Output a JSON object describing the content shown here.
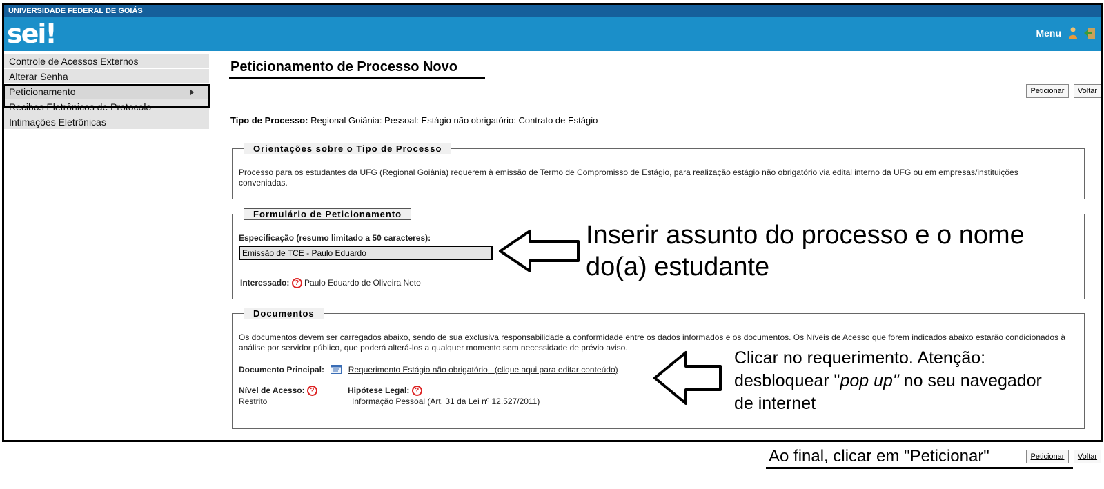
{
  "header": {
    "university": "UNIVERSIDADE FEDERAL DE GOIÁS",
    "logo_text": "sei",
    "logo_mark": "!",
    "menu_label": "Menu",
    "icons": [
      "user-icon",
      "exit-icon"
    ],
    "bar_color": "#1b8fc9",
    "top_bar_color": "#155f9b"
  },
  "sidebar": {
    "items": [
      {
        "label": "Controle de Acessos Externos"
      },
      {
        "label": "Alterar Senha"
      },
      {
        "label": "Peticionamento"
      },
      {
        "label": "Recibos Eletrônicos de Protocolo"
      },
      {
        "label": "Intimações Eletrônicas"
      }
    ]
  },
  "main": {
    "title": "Peticionamento de Processo Novo",
    "buttons": {
      "peticionar": "Peticionar",
      "voltar": "Voltar"
    },
    "tipo_label": "Tipo de Processo:",
    "tipo_value": "Regional Goiânia: Pessoal: Estágio não obrigatório: Contrato de Estágio",
    "orientacoes": {
      "legend": "Orientações sobre o Tipo de Processo",
      "text": "Processo para os estudantes da UFG (Regional Goiânia) requerem à emissão de Termo de Compromisso de Estágio, para realização estágio não obrigatório via edital interno da UFG ou em empresas/instituições conveniadas."
    },
    "formulario": {
      "legend": "Formulário de Peticionamento",
      "espec_label": "Especificação (resumo limitado a 50 caracteres):",
      "espec_value": "Emissão de TCE - Paulo Eduardo",
      "interessado_label": "Interessado:",
      "interessado_value": "Paulo Eduardo de Oliveira Neto"
    },
    "documentos": {
      "legend": "Documentos",
      "text": "Os documentos devem ser carregados abaixo, sendo de sua exclusiva responsabilidade a conformidade entre os dados informados e os documentos. Os Níveis de Acesso que forem indicados abaixo estarão condicionados à análise por servidor público, que poderá alterá-los a qualquer momento sem necessidade de prévio aviso.",
      "principal_label": "Documento Principal:",
      "principal_link": "Requerimento Estágio não obrigatório",
      "principal_edit": "(clique aqui para editar conteúdo)",
      "nivel_label": "Nível de Acesso:",
      "nivel_value": "Restrito",
      "hipotese_label": "Hipótese Legal:",
      "hipotese_value": "Informação Pessoal (Art. 31 da Lei nº 12.527/2011)"
    }
  },
  "annotations": {
    "specification_note": "Inserir assunto do processo e o nome do(a) estudante",
    "document_note_1": "Clicar no requerimento. Atenção:",
    "document_note_2_pre": "desbloquear \"",
    "document_note_2_italic": "pop up\"",
    "document_note_2_post": " no seu navegador",
    "document_note_3": "de internet",
    "final_note": "Ao final, clicar em \"Peticionar\""
  }
}
